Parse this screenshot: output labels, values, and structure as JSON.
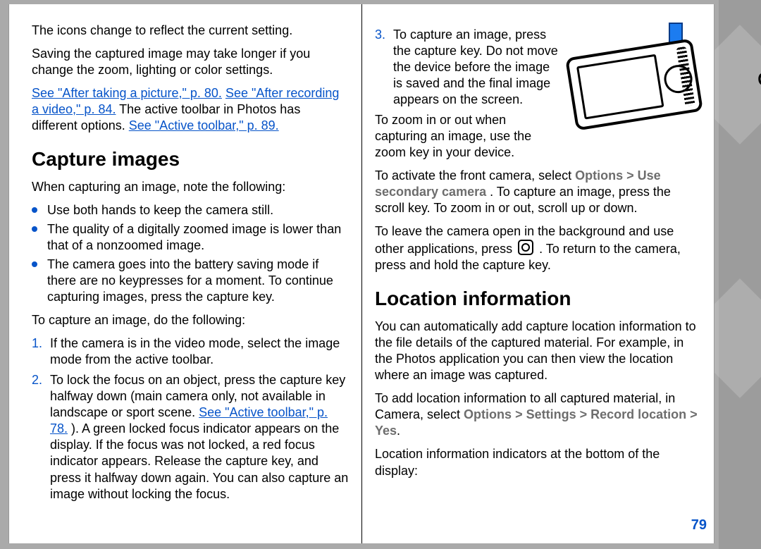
{
  "side_label": "Camera",
  "page_number": "79",
  "left": {
    "p1": "The icons change to reflect the current setting.",
    "p2": "Saving the captured image may take longer if you change the zoom, lighting or color settings.",
    "link1": "See \"After taking a picture,\" p. 80.",
    "link2": "See \"After recording a video,\" p. 84.",
    "p3_mid": " The active toolbar in Photos has different options. ",
    "link3": "See \"Active toolbar,\" p. 89.",
    "h_capture": "Capture images",
    "p4": "When capturing an image, note the following:",
    "bullets": [
      "Use both hands to keep the camera still.",
      "The quality of a digitally zoomed image is lower than that of a nonzoomed image.",
      "The camera goes into the battery saving mode if there are no keypresses for a moment. To continue capturing images, press the capture key."
    ],
    "p5": "To capture an image, do the following:",
    "steps": {
      "s1_n": "1.",
      "s1": "If the camera is in the video mode, select the image mode from the active toolbar.",
      "s2_n": "2.",
      "s2a": "To lock the focus on an object, press the capture key halfway down (main camera only, not available in landscape or sport scene. ",
      "s2_link": "See \"Active toolbar,\" p. 78.",
      "s2b": "). A green locked focus indicator appears on the display. If the focus was not locked, a red focus indicator appears. Release the capture key, and press it halfway down again. You can also capture an image without locking the focus."
    }
  },
  "right": {
    "s3_n": "3.",
    "s3": "To capture an image, press the capture key. Do not move the device before the image is saved and the final image appears on the screen.",
    "p_zoom": "To zoom in or out when capturing an image, use the zoom key in your device.",
    "p_front_a": "To activate the front camera, select ",
    "m_options": "Options",
    "gt": " > ",
    "m_use_secondary": "Use secondary camera",
    "p_front_b": ". To capture an image, press the scroll key. To zoom in or out, scroll up or down.",
    "p_bg_a": "To leave the camera open in the background and use other applications, press ",
    "p_bg_b": " . To return to the camera, press and hold the capture key.",
    "h_location": "Location information",
    "p_loc1": "You can automatically add capture location information to the file details of the captured material. For example, in the Photos application you can then view the location where an image was captured.",
    "p_loc2_a": "To add location information to all captured material, in Camera, select ",
    "m_settings": "Settings",
    "m_record": "Record location",
    "m_yes": "Yes",
    "p_loc3": "Location information indicators at the bottom of the display:"
  }
}
